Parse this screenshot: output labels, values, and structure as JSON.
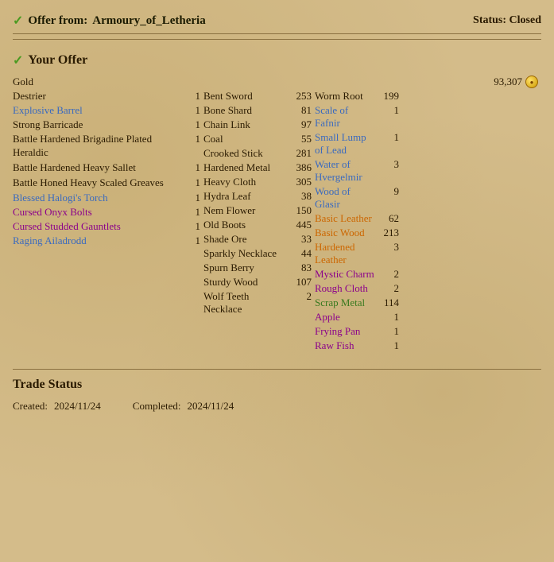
{
  "header": {
    "offer_from_label": "Offer from:",
    "offer_from_name": "Armoury_of_Letheria",
    "status_label": "Status: Closed"
  },
  "your_offer": {
    "section_label": "Your Offer",
    "gold_label": "Gold",
    "gold_amount": "93,307",
    "col1_items": [
      {
        "name": "Destrier",
        "qty": "1",
        "color": "default"
      },
      {
        "name": "Explosive Barrel",
        "qty": "1",
        "color": "blue"
      },
      {
        "name": "Strong Barricade",
        "qty": "1",
        "color": "default"
      },
      {
        "name": "Battle Hardened Brigadine Plated Heraldic",
        "qty": "1",
        "color": "default",
        "multiline": true
      },
      {
        "name": "Battle Hardened Heavy Sallet",
        "qty": "1",
        "color": "default",
        "multiline": true
      },
      {
        "name": "Battle Honed Heavy Scaled Greaves",
        "qty": "1",
        "color": "default",
        "multiline": true
      },
      {
        "name": "Blessed Halogi's Torch",
        "qty": "1",
        "color": "blue"
      },
      {
        "name": "Cursed Onyx Bolts",
        "qty": "1",
        "color": "purple"
      },
      {
        "name": "Cursed Studded Gauntlets",
        "qty": "1",
        "color": "purple",
        "multiline": true
      },
      {
        "name": "Raging Ailadrodd",
        "qty": "1",
        "color": "blue"
      }
    ],
    "col2_items": [
      {
        "name": "Bent Sword",
        "qty": "253",
        "color": "default"
      },
      {
        "name": "Bone Shard",
        "qty": "81",
        "color": "default"
      },
      {
        "name": "Chain Link",
        "qty": "97",
        "color": "default"
      },
      {
        "name": "Coal",
        "qty": "55",
        "color": "default"
      },
      {
        "name": "Crooked Stick",
        "qty": "281",
        "color": "default"
      },
      {
        "name": "Hardened Metal",
        "qty": "386",
        "color": "default"
      },
      {
        "name": "Heavy Cloth",
        "qty": "305",
        "color": "default"
      },
      {
        "name": "Hydra Leaf",
        "qty": "38",
        "color": "default"
      },
      {
        "name": "Nem Flower",
        "qty": "150",
        "color": "default"
      },
      {
        "name": "Old Boots",
        "qty": "445",
        "color": "default"
      },
      {
        "name": "Shade Ore",
        "qty": "33",
        "color": "default"
      },
      {
        "name": "Sparkly Necklace",
        "qty": "44",
        "color": "default"
      },
      {
        "name": "Spurn Berry",
        "qty": "83",
        "color": "default"
      },
      {
        "name": "Sturdy Wood",
        "qty": "107",
        "color": "default"
      },
      {
        "name": "Wolf Teeth Necklace",
        "qty": "2",
        "color": "default"
      }
    ],
    "col3_items": [
      {
        "name": "Worm Root",
        "qty": "199",
        "color": "default"
      },
      {
        "name": "Scale of Fafnir",
        "qty": "1",
        "color": "blue"
      },
      {
        "name": "Small Lump of Lead",
        "qty": "1",
        "color": "blue"
      },
      {
        "name": "Water of Hvergelmir",
        "qty": "3",
        "color": "blue"
      },
      {
        "name": "Wood of Glasir",
        "qty": "9",
        "color": "blue"
      },
      {
        "name": "Basic Leather",
        "qty": "62",
        "color": "orange"
      },
      {
        "name": "Basic Wood",
        "qty": "213",
        "color": "orange"
      },
      {
        "name": "Hardened Leather",
        "qty": "3",
        "color": "orange"
      },
      {
        "name": "Mystic Charm",
        "qty": "2",
        "color": "purple"
      },
      {
        "name": "Rough Cloth",
        "qty": "2",
        "color": "purple"
      },
      {
        "name": "Scrap Metal",
        "qty": "114",
        "color": "green"
      },
      {
        "name": "Apple",
        "qty": "1",
        "color": "purple"
      },
      {
        "name": "Frying Pan",
        "qty": "1",
        "color": "purple"
      },
      {
        "name": "Raw Fish",
        "qty": "1",
        "color": "purple"
      }
    ]
  },
  "trade_status": {
    "title": "Trade Status",
    "created_label": "Created:",
    "created_date": "2024/11/24",
    "completed_label": "Completed:",
    "completed_date": "2024/11/24"
  }
}
